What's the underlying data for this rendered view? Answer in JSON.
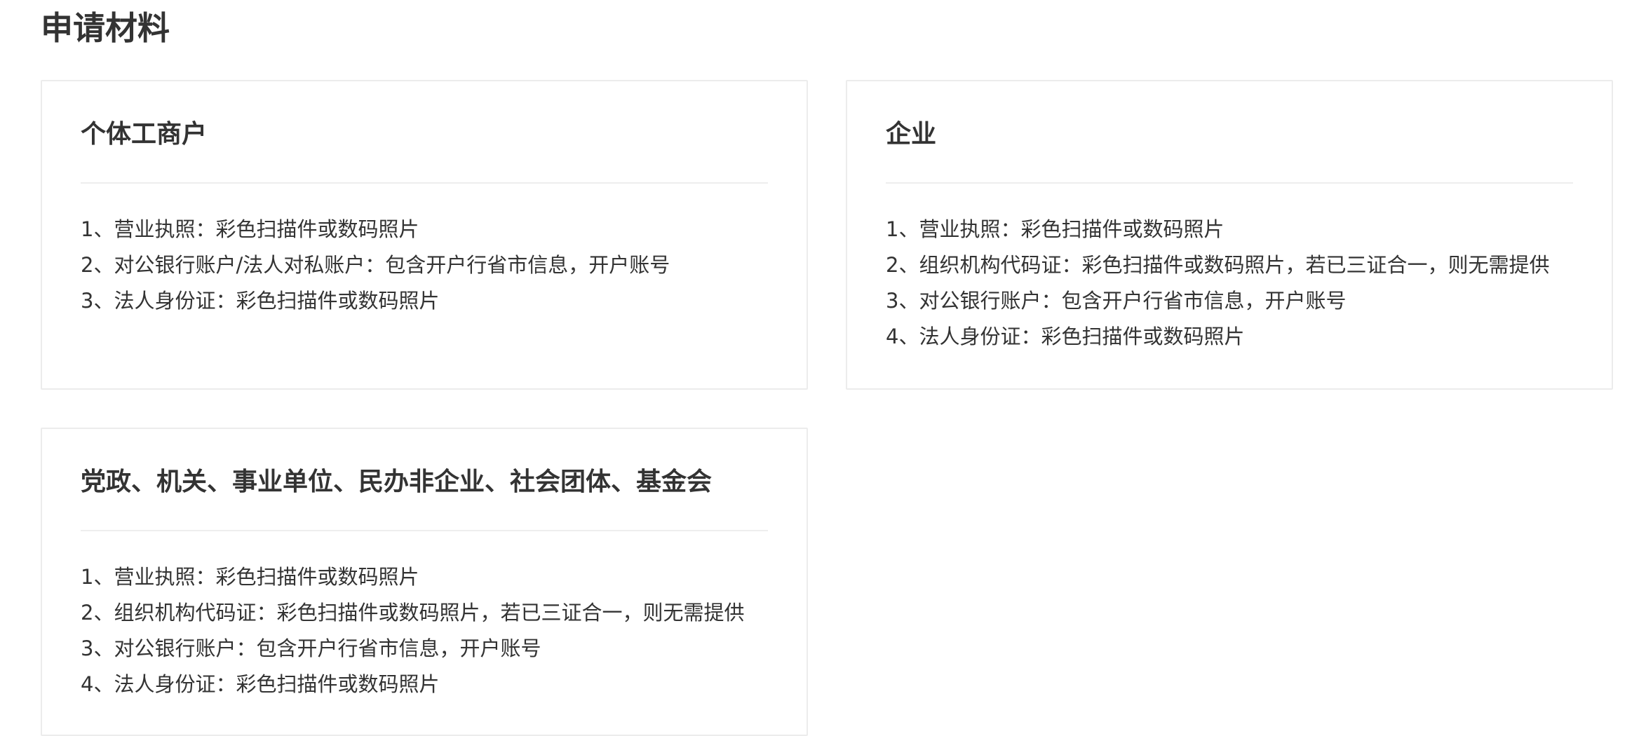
{
  "page_title": "申请材料",
  "cards": [
    {
      "title": "个体工商户",
      "items": [
        "1、营业执照：彩色扫描件或数码照片",
        "2、对公银行账户/法人对私账户：包含开户行省市信息，开户账号",
        "3、法人身份证：彩色扫描件或数码照片"
      ]
    },
    {
      "title": "企业",
      "items": [
        "1、营业执照：彩色扫描件或数码照片",
        "2、组织机构代码证：彩色扫描件或数码照片，若已三证合一，则无需提供",
        "3、对公银行账户：包含开户行省市信息，开户账号",
        "4、法人身份证：彩色扫描件或数码照片"
      ]
    },
    {
      "title": "党政、机关、事业单位、民办非企业、社会团体、基金会",
      "items": [
        "1、营业执照：彩色扫描件或数码照片",
        "2、组织机构代码证：彩色扫描件或数码照片，若已三证合一，则无需提供",
        "3、对公银行账户：包含开户行省市信息，开户账号",
        "4、法人身份证：彩色扫描件或数码照片"
      ]
    }
  ]
}
